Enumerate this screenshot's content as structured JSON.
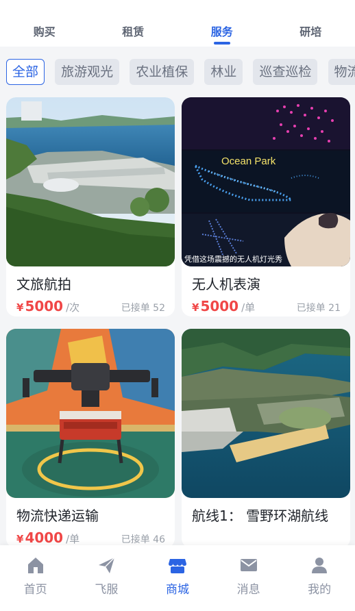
{
  "top_tabs": [
    {
      "label": "购买"
    },
    {
      "label": "租赁"
    },
    {
      "label": "服务"
    },
    {
      "label": "研培"
    }
  ],
  "active_tab": "服务",
  "chips": [
    {
      "label": "全部"
    },
    {
      "label": "旅游观光"
    },
    {
      "label": "农业植保"
    },
    {
      "label": "林业"
    },
    {
      "label": "巡查巡检"
    },
    {
      "label": "物流"
    }
  ],
  "cards": [
    {
      "title": "文旅航拍",
      "currency": "¥",
      "price": "5000",
      "unit": "/次",
      "orders": "已接单 52"
    },
    {
      "title": "无人机表演",
      "currency": "¥",
      "price": "5000",
      "unit": "/单",
      "orders": "已接单 21",
      "image_caption": "凭借这场震撼的无人机灯光秀",
      "image_sign": "Ocean Park"
    },
    {
      "title": "物流快递运输",
      "currency": "¥",
      "price": "4000",
      "unit": "/单",
      "orders": "已接单 46"
    },
    {
      "title": "航线1： 雪野环湖航线"
    }
  ],
  "bottom_nav": [
    {
      "label": "首页",
      "icon": "home-icon"
    },
    {
      "label": "飞服",
      "icon": "paper-plane-icon"
    },
    {
      "label": "商城",
      "icon": "store-icon"
    },
    {
      "label": "消息",
      "icon": "mail-icon"
    },
    {
      "label": "我的",
      "icon": "user-icon"
    }
  ],
  "colors": {
    "accent": "#2b64e3",
    "price": "#f04747"
  }
}
